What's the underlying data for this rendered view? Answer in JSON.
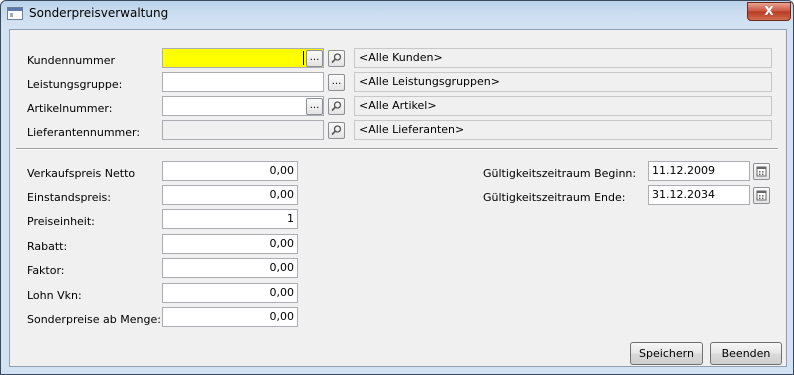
{
  "window": {
    "title": "Sonderpreisverwaltung",
    "close_glyph": "X"
  },
  "filters": [
    {
      "label": "Kundennummer",
      "value": "",
      "desc": "<Alle Kunden>"
    },
    {
      "label": "Leistungsgruppe:",
      "value": "",
      "desc": "<Alle Leistungsgruppen>"
    },
    {
      "label": "Artikelnummer:",
      "value": "",
      "desc": "<Alle Artikel>"
    },
    {
      "label": "Lieferantennummer:",
      "value": "",
      "desc": "<Alle Lieferanten>"
    }
  ],
  "prices": [
    {
      "label": "Verkaufspreis Netto",
      "value": "0,00"
    },
    {
      "label": "Einstandspreis:",
      "value": "0,00"
    },
    {
      "label": "Preiseinheit:",
      "value": "1"
    },
    {
      "label": "Rabatt:",
      "value": "0,00"
    },
    {
      "label": "Faktor:",
      "value": "0,00"
    },
    {
      "label": "Lohn Vkn:",
      "value": "0,00"
    },
    {
      "label": "Sonderpreise ab Menge:",
      "value": "0,00"
    }
  ],
  "validity": {
    "start_label": "Gültigkeitszeitraum Beginn:",
    "start_value": "11.12.2009",
    "end_label": "Gültigkeitszeitraum Ende:",
    "end_value": "31.12.2034"
  },
  "buttons": {
    "browse": "...",
    "save": "Speichern",
    "close": "Beenden"
  },
  "icons": {
    "search": "search-icon",
    "calendar": "calendar-icon",
    "browse": "ellipsis-icon"
  }
}
